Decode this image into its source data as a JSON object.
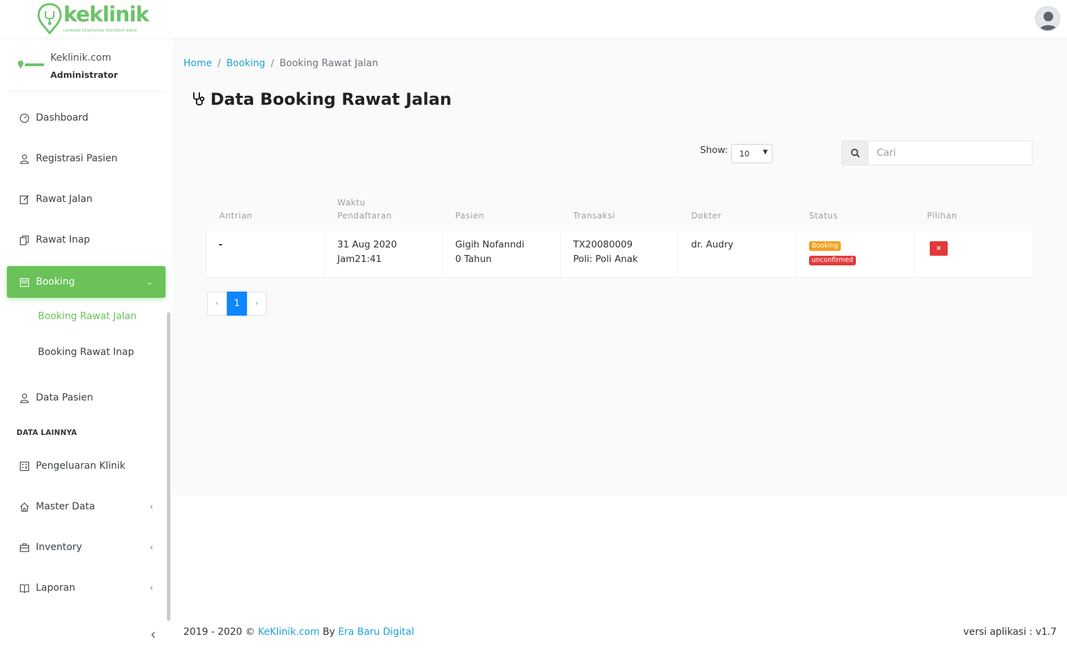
{
  "header": {
    "brand": "keklinik",
    "tagline": "LAYANAN KESEHATAN TERDEKAT ANDA",
    "brand_color": "#6cc36a"
  },
  "sidebar": {
    "profile": {
      "site": "Keklinik.com",
      "role": "Administrator"
    },
    "items": [
      {
        "label": "Dashboard",
        "icon": "dashboard-icon"
      },
      {
        "label": "Registrasi Pasien",
        "icon": "user-icon"
      },
      {
        "label": "Rawat Jalan",
        "icon": "edit-icon"
      },
      {
        "label": "Rawat Inap",
        "icon": "copy-icon"
      },
      {
        "label": "Booking",
        "icon": "calendar-icon",
        "active": true
      },
      {
        "label": "Data Pasien",
        "icon": "user-icon"
      },
      {
        "label": "Pengeluaran Klinik",
        "icon": "calculator-icon"
      },
      {
        "label": "Master Data",
        "icon": "home-icon"
      },
      {
        "label": "Inventory",
        "icon": "briefcase-icon"
      },
      {
        "label": "Laporan",
        "icon": "book-icon"
      }
    ],
    "sub_items": [
      {
        "label": "Booking Rawat Jalan",
        "active": true
      },
      {
        "label": "Booking Rawat Inap"
      }
    ],
    "section_title": "DATA LAINNYA",
    "active_color": "#6ac259"
  },
  "breadcrumb": {
    "home": "Home",
    "booking": "Booking",
    "current": "Booking Rawat Jalan"
  },
  "page": {
    "title": "Data Booking Rawat Jalan"
  },
  "controls": {
    "show_label": "Show:",
    "show_value": "10",
    "search_placeholder": "Cari"
  },
  "table": {
    "headers": [
      "Antrian",
      "Waktu",
      "Pendaftaran",
      "Pasien",
      "Transaksi",
      "Dokter",
      "Status",
      "Pilihan"
    ],
    "rows": [
      {
        "antrian": "-",
        "tanggal": "31 Aug 2020",
        "jam": "Jam21:41",
        "pasien": "Gigih Nofanndi",
        "umur": "0 Tahun",
        "transaksi": "TX20080009",
        "poli": "Poli: Poli Anak",
        "dokter": "dr. Audry",
        "status_1": "Booking",
        "status_2": "unconfirmed",
        "delete": "×"
      }
    ]
  },
  "pagination": {
    "prev": "‹",
    "current": "1",
    "next": "›",
    "current_color": "#0d86ff"
  },
  "footer": {
    "years": "2019 - 2020 ©",
    "site_link": "KeKlinik.com",
    "by": "By",
    "company_link": "Era Baru Digital",
    "version": "versi aplikasi : v1.7"
  }
}
